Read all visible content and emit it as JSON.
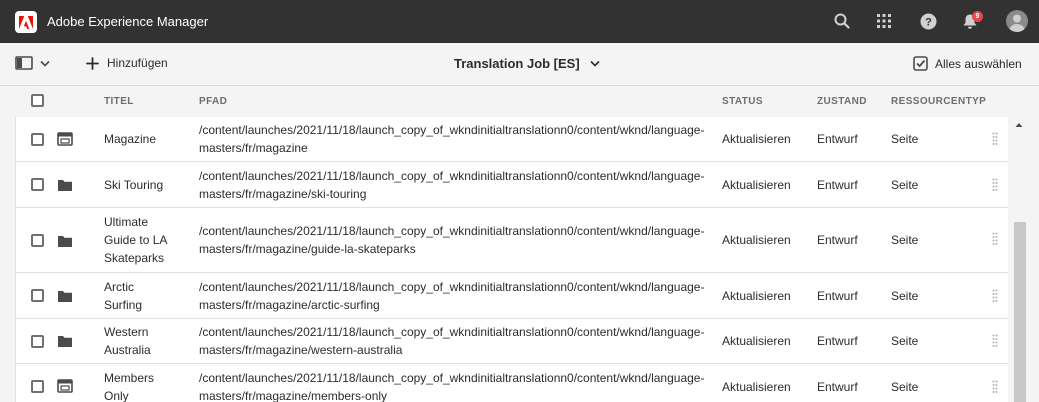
{
  "shell": {
    "app_title": "Adobe Experience Manager",
    "notification_count": "9"
  },
  "actionbar": {
    "add_label": "Hinzufügen",
    "title": "Translation Job [ES]",
    "select_all_label": "Alles auswählen"
  },
  "table": {
    "columns": [
      "TITEL",
      "PFAD",
      "STATUS",
      "ZUSTAND",
      "RESSOURCENTYP"
    ],
    "rows": [
      {
        "title_lines": [
          "Magazine"
        ],
        "icon": "page-icon",
        "path_lines": [
          "/content/launches/2021/11/18/launch_copy_of_wkndinitialtranslationn0/content/wknd/language-",
          "masters/fr/magazine"
        ],
        "status": "Aktualisieren",
        "state": "Entwurf",
        "type": "Seite"
      },
      {
        "title_lines": [
          "Ski Touring"
        ],
        "icon": "folder-icon",
        "path_lines": [
          "/content/launches/2021/11/18/launch_copy_of_wkndinitialtranslationn0/content/wknd/language-",
          "masters/fr/magazine/ski-touring"
        ],
        "status": "Aktualisieren",
        "state": "Entwurf",
        "type": "Seite"
      },
      {
        "title_lines": [
          "Ultimate",
          "Guide to LA",
          "Skateparks"
        ],
        "icon": "folder-icon",
        "path_lines": [
          "/content/launches/2021/11/18/launch_copy_of_wkndinitialtranslationn0/content/wknd/language-",
          "masters/fr/magazine/guide-la-skateparks"
        ],
        "status": "Aktualisieren",
        "state": "Entwurf",
        "type": "Seite"
      },
      {
        "title_lines": [
          "Arctic",
          "Surfing"
        ],
        "icon": "folder-icon",
        "path_lines": [
          "/content/launches/2021/11/18/launch_copy_of_wkndinitialtranslationn0/content/wknd/language-",
          "masters/fr/magazine/arctic-surfing"
        ],
        "status": "Aktualisieren",
        "state": "Entwurf",
        "type": "Seite"
      },
      {
        "title_lines": [
          "Western",
          "Australia"
        ],
        "icon": "folder-icon",
        "path_lines": [
          "/content/launches/2021/11/18/launch_copy_of_wkndinitialtranslationn0/content/wknd/language-",
          "masters/fr/magazine/western-australia"
        ],
        "status": "Aktualisieren",
        "state": "Entwurf",
        "type": "Seite"
      },
      {
        "title_lines": [
          "Members",
          "Only"
        ],
        "icon": "page-icon",
        "path_lines": [
          "/content/launches/2021/11/18/launch_copy_of_wkndinitialtranslationn0/content/wknd/language-",
          "masters/fr/magazine/members-only"
        ],
        "status": "Aktualisieren",
        "state": "Entwurf",
        "type": "Seite"
      }
    ]
  },
  "colors": {
    "shell_bg": "#323232",
    "brand_red": "#eb1000",
    "badge": "#e34850"
  }
}
